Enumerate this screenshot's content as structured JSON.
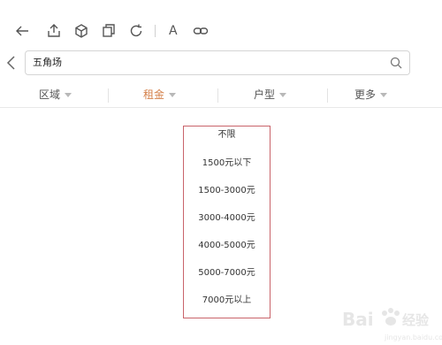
{
  "toolbar": {
    "icons": [
      "back-arrow-icon",
      "share-icon",
      "cube-icon",
      "copy-icon",
      "refresh-icon",
      "text-icon",
      "link-icon"
    ],
    "text_glyph": "A"
  },
  "search": {
    "value": "五角场",
    "placeholder": ""
  },
  "filters": {
    "tabs": [
      {
        "label": "区域",
        "active": false
      },
      {
        "label": "租金",
        "active": true
      },
      {
        "label": "户型",
        "active": false
      },
      {
        "label": "更多",
        "active": false
      }
    ]
  },
  "rent_options": [
    "不限",
    "1500元以下",
    "1500-3000元",
    "3000-4000元",
    "4000-5000元",
    "5000-7000元",
    "7000元以上"
  ],
  "watermark": {
    "text": "Bai经验"
  },
  "colors": {
    "accent": "#d4804a",
    "dropdown_border": "#c9636a",
    "text": "#333333"
  }
}
